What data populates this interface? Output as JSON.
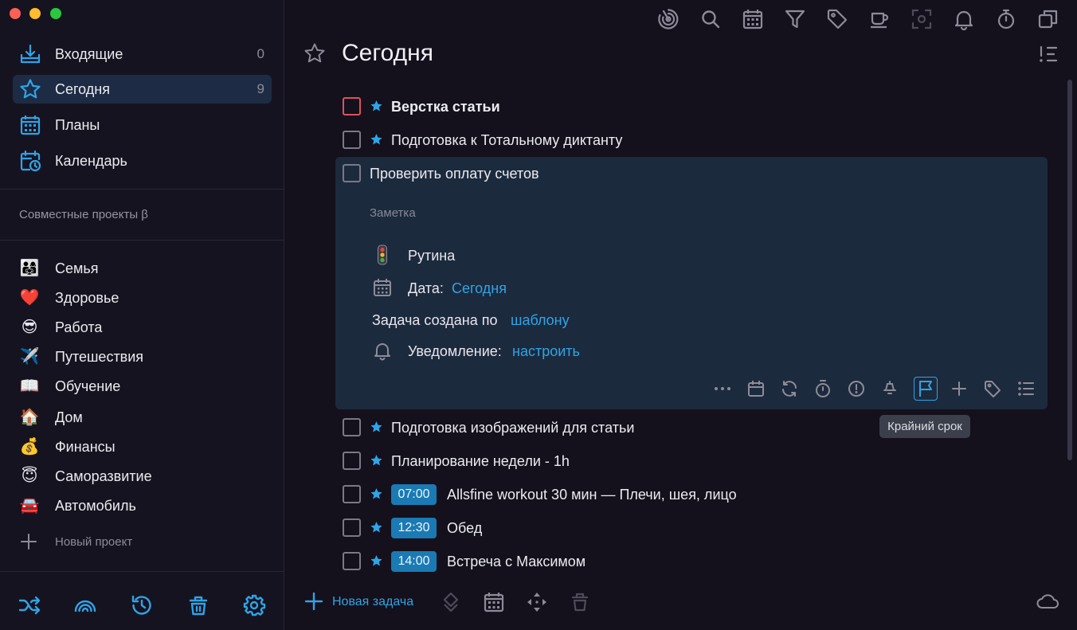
{
  "sidebar": {
    "nav": [
      {
        "label": "Входящие",
        "count": "0",
        "icon": "inbox-icon"
      },
      {
        "label": "Сегодня",
        "count": "9",
        "icon": "star-icon"
      },
      {
        "label": "Планы",
        "count": "",
        "icon": "calendar-grid-icon"
      },
      {
        "label": "Календарь",
        "count": "",
        "icon": "calendar-clock-icon"
      }
    ],
    "shared_title": "Совместные проекты β",
    "projects": [
      {
        "emoji": "👨‍👩‍👧",
        "label": "Семья"
      },
      {
        "emoji": "❤️",
        "label": "Здоровье"
      },
      {
        "emoji": "😎",
        "label": "Работа"
      },
      {
        "emoji": "✈️",
        "label": "Путешествия"
      },
      {
        "emoji": "📖",
        "label": "Обучение"
      },
      {
        "emoji": "🏠",
        "label": "Дом"
      },
      {
        "emoji": "💰",
        "label": "Финансы"
      },
      {
        "emoji": "😇",
        "label": "Саморазвитие"
      },
      {
        "emoji": "🚘",
        "label": "Автомобиль"
      }
    ],
    "new_project": "Новый проект",
    "bottom_icons": [
      "shuffle-icon",
      "broadcast-icon",
      "history-icon",
      "trash-icon",
      "settings-icon"
    ]
  },
  "toolbar": {
    "icons": [
      "focus-icon",
      "search-icon",
      "calendar-icon",
      "filter-icon",
      "tag-icon",
      "coffee-icon",
      "scan-icon",
      "bell-icon",
      "timer-icon",
      "windows-icon"
    ]
  },
  "main": {
    "title": "Сегодня",
    "tasks": [
      {
        "label": "Верстка статьи",
        "bold": true,
        "urgent": true,
        "star": true,
        "time": ""
      },
      {
        "label": "Подготовка к Тотальному диктанту",
        "bold": false,
        "urgent": false,
        "star": true,
        "time": ""
      },
      {
        "label": "Подготовка изображений для статьи",
        "bold": false,
        "urgent": false,
        "star": true,
        "time": ""
      },
      {
        "label": "Планирование недели - 1h",
        "bold": false,
        "urgent": false,
        "star": true,
        "time": ""
      },
      {
        "label": "Allsfine workout 30 мин — Плечи, шея, лицо",
        "bold": false,
        "urgent": false,
        "star": true,
        "time": "07:00"
      },
      {
        "label": "Обед",
        "bold": false,
        "urgent": false,
        "star": true,
        "time": "12:30"
      },
      {
        "label": "Встреча с Максимом",
        "bold": false,
        "urgent": false,
        "star": true,
        "time": "14:00"
      }
    ],
    "expanded": {
      "title": "Проверить оплату счетов",
      "note_placeholder": "Заметка",
      "routine": "Рутина",
      "date_label": "Дата:",
      "date_value": "Сегодня",
      "template_text": "Задача создана по",
      "template_link": "шаблону",
      "reminder_label": "Уведомление:",
      "reminder_link": "настроить",
      "actions": [
        "more-icon",
        "calendar-icon",
        "repeat-icon",
        "timer-icon",
        "priority-icon",
        "bell-off-icon",
        "flag-icon",
        "plus-icon",
        "tag-icon",
        "checklist-icon"
      ],
      "tooltip": "Крайний срок"
    },
    "footer": {
      "new_task": "Новая задача",
      "icons": [
        "layers-icon",
        "calendar-icon",
        "move-icon",
        "trash-icon",
        "cloud-icon"
      ]
    }
  },
  "colors": {
    "accent": "#2fa4e7",
    "active_bg": "#1d2c44",
    "card_bg": "#1c2a3d",
    "urgent": "#d9545b",
    "time_badge": "#1a7ab4"
  }
}
